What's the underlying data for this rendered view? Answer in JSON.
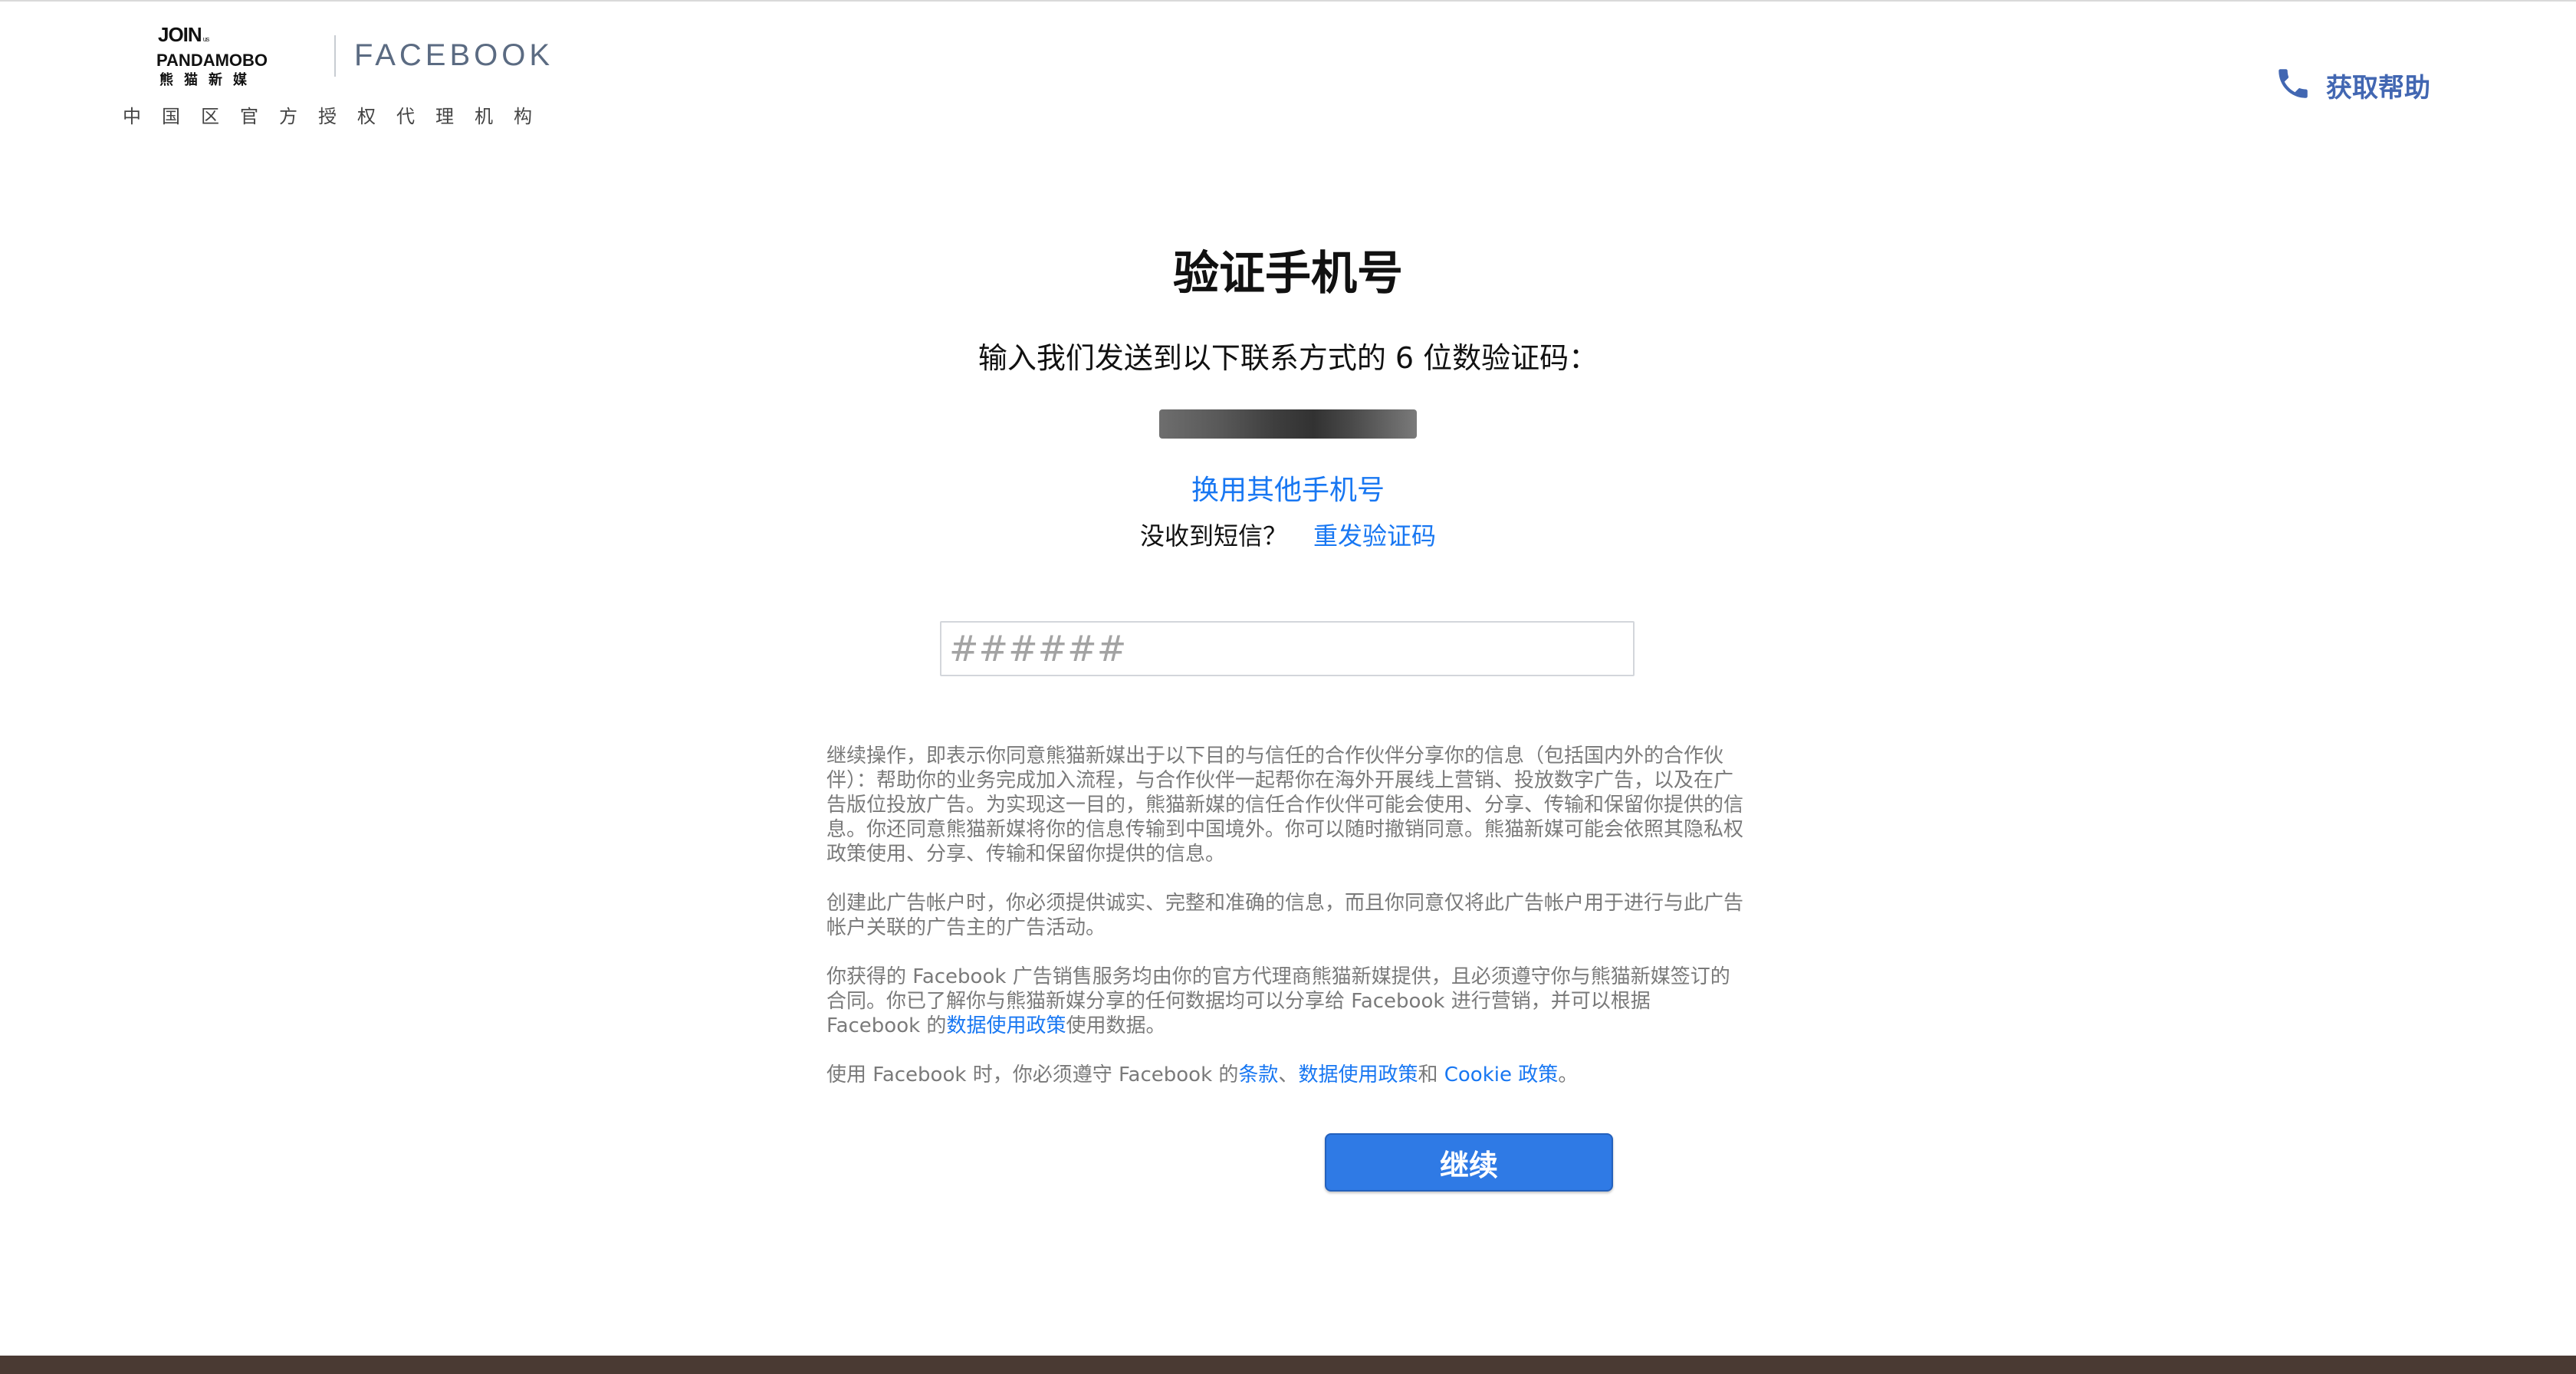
{
  "header": {
    "logo_join": "JOIN",
    "logo_join_small": "us",
    "logo_pandamobo": "PANDAMOBO",
    "logo_cn": "熊猫新媒",
    "logo_facebook": "FACEBOOK",
    "subtitle": "中国区官方授权代理机构",
    "help_label": "获取帮助",
    "help_icon": "phone-icon"
  },
  "main": {
    "title": "验证手机号",
    "instruction": "输入我们发送到以下联系方式的 6 位数验证码：",
    "change_phone_link": "换用其他手机号",
    "resend_prompt": "没收到短信？",
    "resend_link": "重发验证码",
    "code_placeholder": "######",
    "code_value": ""
  },
  "legal": {
    "p1": "继续操作，即表示你同意熊猫新媒出于以下目的与信任的合作伙伴分享你的信息（包括国内外的合作伙伴）：帮助你的业务完成加入流程，与合作伙伴一起帮你在海外开展线上营销、投放数字广告，以及在广告版位投放广告。为实现这一目的，熊猫新媒的信任合作伙伴可能会使用、分享、传输和保留你提供的信息。你还同意熊猫新媒将你的信息传输到中国境外。你可以随时撤销同意。熊猫新媒可能会依照其隐私权政策使用、分享、传输和保留你提供的信息。",
    "p2": "创建此广告帐户时，你必须提供诚实、完整和准确的信息，而且你同意仅将此广告帐户用于进行与此广告帐户关联的广告主的广告活动。",
    "p3_part1": "你获得的 Facebook 广告销售服务均由你的官方代理商熊猫新媒提供，且必须遵守你与熊猫新媒签订的合同。你已了解你与熊猫新媒分享的任何数据均可以分享给 Facebook 进行营销，并可以根据 Facebook 的",
    "p3_link": "数据使用政策",
    "p3_part2": "使用数据。",
    "p4_part1": "使用 Facebook 时，你必须遵守 Facebook 的",
    "p4_link_terms": "条款",
    "p4_sep": "、",
    "p4_link_data": "数据使用政策",
    "p4_and": "和 ",
    "p4_link_cookie": "Cookie 政策",
    "p4_end": "。"
  },
  "actions": {
    "continue_label": "继续"
  },
  "colors": {
    "link": "#1877f2",
    "help": "#4267b2",
    "button": "#2f7ae5",
    "legal_text": "#7a7a7a"
  }
}
